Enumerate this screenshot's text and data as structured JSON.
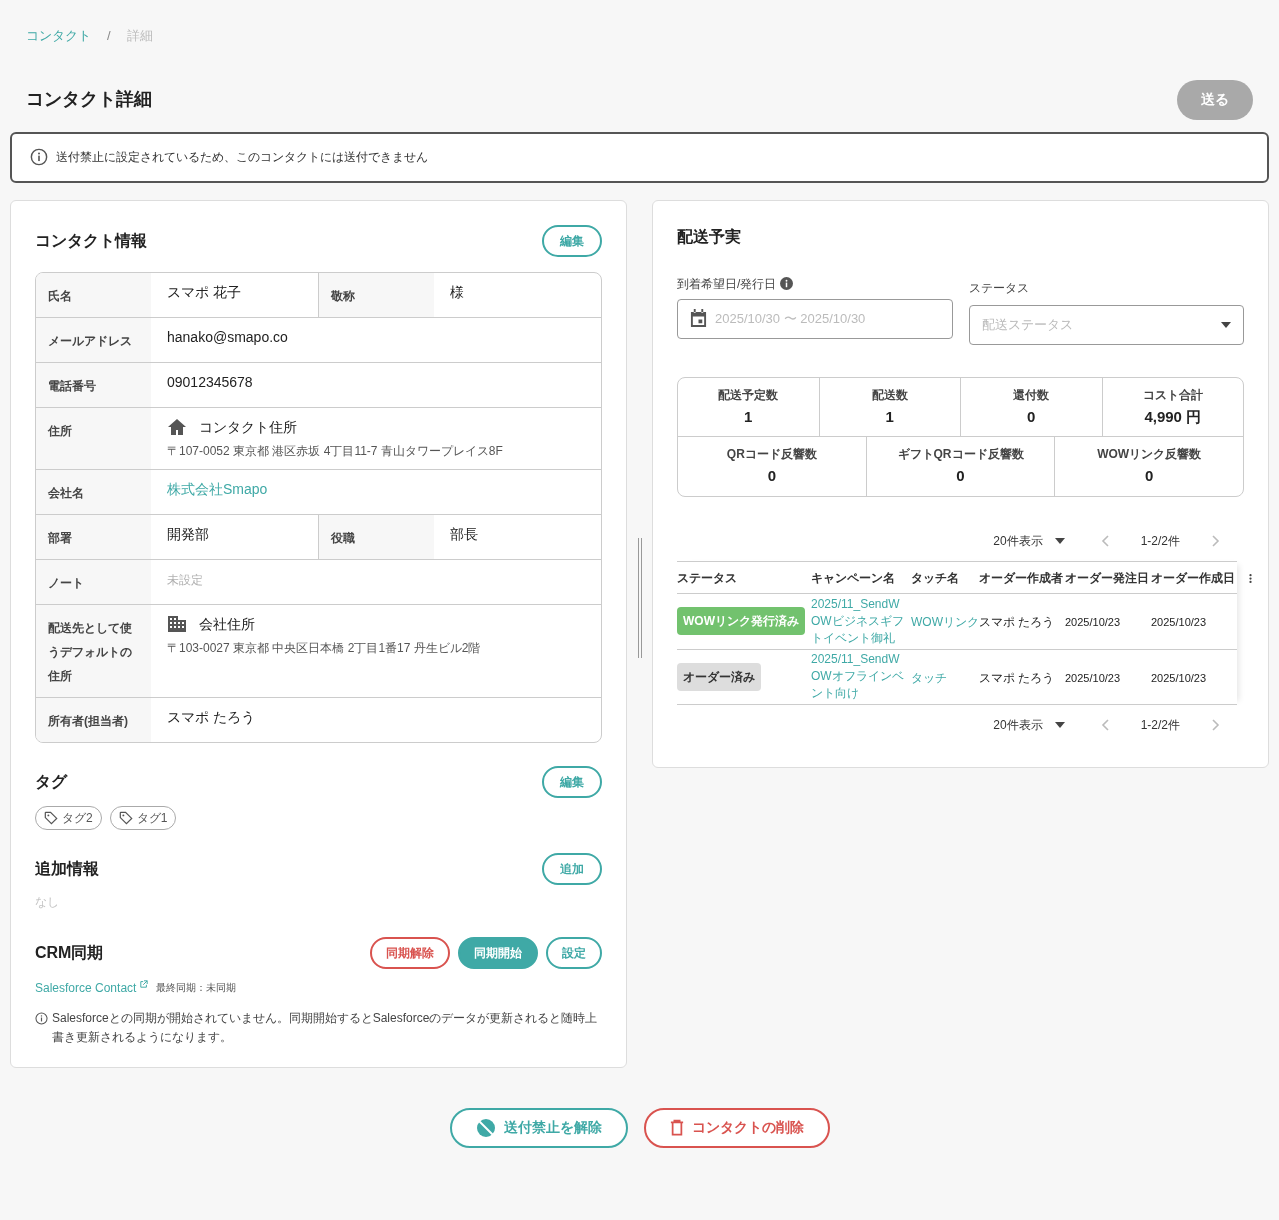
{
  "breadcrumb": [
    {
      "label": "コンタクト",
      "kind": "link"
    },
    {
      "label": "/",
      "kind": "separator"
    },
    {
      "label": "詳細",
      "kind": "current"
    }
  ],
  "page_title": "コンタクト詳細",
  "send_button": {
    "label": "送る",
    "disabled": true
  },
  "notice": "送付禁止に設定されているため、このコンタクトには送付できません",
  "contact_info": {
    "title": "コンタクト情報",
    "edit_button": "編集",
    "rows": [
      {
        "kind": "pair",
        "label": "氏名",
        "value": "スマポ 花子",
        "label2": "敬称",
        "value2": "様"
      },
      {
        "kind": "single",
        "label": "メールアドレス",
        "value": "hanako@smapo.co"
      },
      {
        "kind": "single",
        "label": "電話番号",
        "value": "09012345678"
      },
      {
        "kind": "home_address",
        "label": "住所",
        "value": "コンタクト住所",
        "address": "〒107-0052 東京都 港区赤坂 4丁目11-7 青山タワープレイス8F"
      },
      {
        "kind": "link",
        "label": "会社名",
        "value": "株式会社Smapo"
      },
      {
        "kind": "pair",
        "label": "部署",
        "value": "開発部",
        "label2": "役職",
        "value2": "部長"
      },
      {
        "kind": "empty",
        "label": "ノート",
        "value": "未設定"
      },
      {
        "kind": "company_address",
        "label": "配送先として使うデフォルトの住所",
        "value": "会社住所",
        "address": "〒103-0027 東京都 中央区日本橋 2丁目1番17 丹生ビル2階"
      },
      {
        "kind": "single",
        "label": "所有者(担当者)",
        "value": "スマポ たろう"
      }
    ]
  },
  "tags": {
    "title": "タグ",
    "edit_button": "編集",
    "items": [
      "タグ2",
      "タグ1"
    ]
  },
  "additional_info": {
    "title": "追加情報",
    "add_button": "追加",
    "empty_text": "なし"
  },
  "crm": {
    "title": "CRM同期",
    "buttons": [
      {
        "label": "同期解除",
        "kind": "danger"
      },
      {
        "label": "同期開始",
        "kind": "primary"
      },
      {
        "label": "設定",
        "kind": "outline"
      }
    ],
    "link": "Salesforce Contact",
    "last_sync": "最終同期：未同期",
    "note": "Salesforceとの同期が開始されていません。同期開始するとSalesforceのデータが更新されると随時上書き更新されるようになります。"
  },
  "delivery": {
    "title": "配送予実",
    "date_filter": {
      "label": "到着希望日/発行日",
      "placeholder": "2025/10/30 〜 2025/10/30"
    },
    "status_filter": {
      "label": "ステータス",
      "placeholder": "配送ステータス"
    },
    "stats": [
      [
        {
          "label": "配送予定数",
          "value": "1"
        },
        {
          "label": "配送数",
          "value": "1"
        },
        {
          "label": "還付数",
          "value": "0"
        },
        {
          "label": "コスト合計",
          "value": "4,990 円"
        }
      ],
      [
        {
          "label": "QRコード反響数",
          "value": "0"
        },
        {
          "label": "ギフトQRコード反響数",
          "value": "0"
        },
        {
          "label": "WOWリンク反響数",
          "value": "0"
        }
      ]
    ],
    "pagination_top": {
      "page_size": "20件表示",
      "range": "1-2/2件"
    },
    "columns": [
      "ステータス",
      "キャンペーン名",
      "タッチ名",
      "オーダー作成者",
      "オーダー発注日",
      "オーダー作成日"
    ],
    "rows": [
      {
        "status": "WOWリンク発行済み",
        "color": "#72c26e",
        "campaign": "2025/11_SendWOWビジネスギフトイベント御礼",
        "touch": "WOWリンク",
        "creator": "スマポ たろう",
        "order_date": "2025/10/23",
        "created_date": "2025/10/23"
      },
      {
        "status": "オーダー済み",
        "color": "#dddddd",
        "campaign": "2025/11_SendWOWオフラインベント向け",
        "touch": "タッチ",
        "creator": "スマポ たろう",
        "order_date": "2025/10/23",
        "created_date": "2025/10/23"
      }
    ],
    "pagination_bottom": {
      "page_size": "20件表示",
      "range": "1-2/2件"
    }
  },
  "footer_buttons": [
    {
      "label": "送付禁止を解除",
      "kind": "unblock"
    },
    {
      "label": "コンタクトの削除",
      "kind": "delete"
    }
  ]
}
